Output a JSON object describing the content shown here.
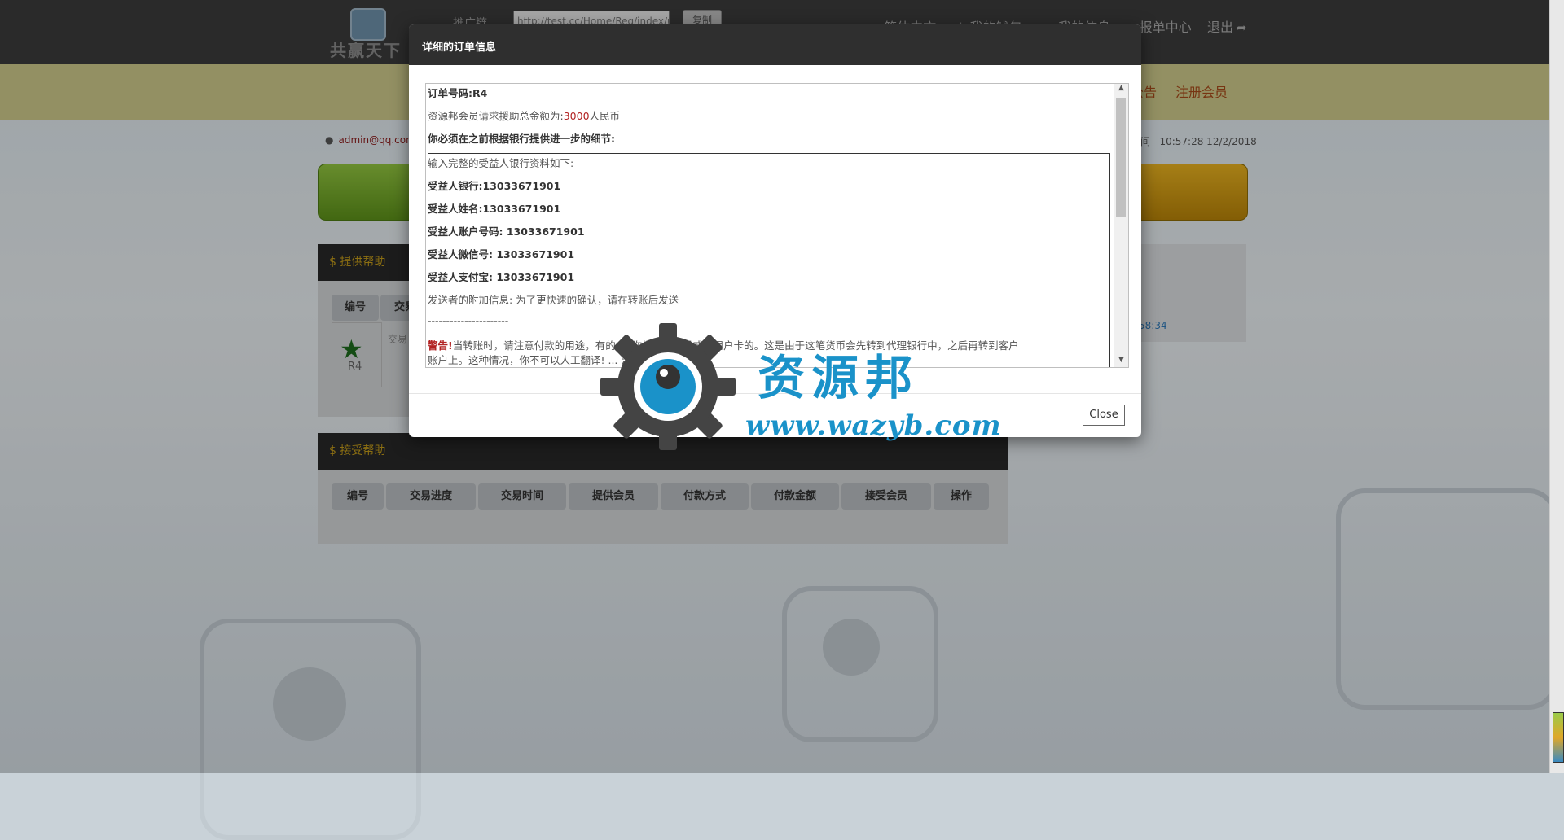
{
  "header": {
    "logo_text": "共赢天下",
    "promo_label": "推广链",
    "promo_url": "http://test.cc/Home/Reg/index/unar",
    "copy_label": "复制",
    "nav": [
      {
        "icon": "flag-icon",
        "label": "简体中文"
      },
      {
        "icon": "dollar-icon",
        "label": "我的钱包"
      },
      {
        "icon": "user-icon",
        "label": "我的信息"
      },
      {
        "icon": "mail-icon",
        "label": "报单中心"
      },
      {
        "icon": "share-icon",
        "label": "退出"
      }
    ]
  },
  "yellow_nav": {
    "announce": "公告",
    "register": "注册会员"
  },
  "user_email": "admin@qq.com",
  "time_label": "间",
  "time_value": "10:57:28 12/2/2018",
  "provide_panel": {
    "title": "$ 提供帮助",
    "headers": [
      "编号",
      "交易"
    ],
    "row": {
      "id": "R4",
      "status": "交易"
    }
  },
  "receive_panel": {
    "title": "$ 接受帮助",
    "headers": [
      "编号",
      "交易进度",
      "交易时间",
      "提供会员",
      "付款方式",
      "付款金额",
      "接受会员",
      "操作"
    ]
  },
  "right_link": "58:34",
  "modal": {
    "title": "详细的订单信息",
    "order_no": "订单号码:R4",
    "amount_prefix": "资源邦会员请求援助总金额为:",
    "amount": "3000",
    "amount_suffix": "人民币",
    "must_provide": "你必须在之前根据银行提供进一步的细节:",
    "input_intro": "输入完整的受益人银行资料如下:",
    "bank": "受益人银行:13033671901",
    "name": "受益人姓名:13033671901",
    "account": "受益人账户号码: 13033671901",
    "wechat": "受益人微信号: 13033671901",
    "alipay": "受益人支付宝: 13033671901",
    "extra": "发送者的附加信息: 为了更快速的确认，请在转账后发送",
    "dashes": "----------------------",
    "warning_label": "警告!",
    "warning_text": "当转账时，请注意付款的用途，有的 ... 你指定的账号或者用户卡的。这是由于这笔货币会先转到代理银行中，之后再转到客户",
    "warning_text2": "账户上。这种情况，你不可以人工翻译! ... 注意收款用户。",
    "close_label": "Close"
  },
  "watermark": {
    "brand": "资源邦",
    "url": "www.wazyb.com"
  }
}
